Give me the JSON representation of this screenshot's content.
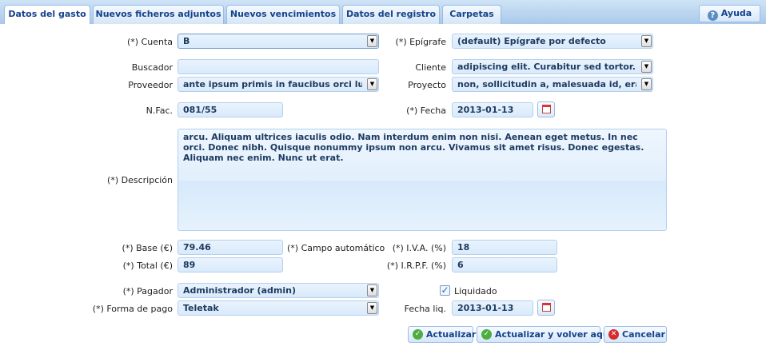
{
  "tabs": [
    {
      "label": "Datos del gasto",
      "active": true
    },
    {
      "label": "Nuevos ficheros adjuntos",
      "active": false
    },
    {
      "label": "Nuevos vencimientos",
      "active": false
    },
    {
      "label": "Datos del registro",
      "active": false
    },
    {
      "label": "Carpetas",
      "active": false
    }
  ],
  "help": {
    "label": "Ayuda",
    "icon": "help-icon"
  },
  "form": {
    "cuenta": {
      "label": "(*) Cuenta",
      "value": "B"
    },
    "epigrafe": {
      "label": "(*) Epígrafe",
      "value": "(default) Epígrafe por defecto"
    },
    "buscador": {
      "label": "Buscador",
      "value": ""
    },
    "cliente": {
      "label": "Cliente",
      "value": "adipiscing elit. Curabitur sed tortor."
    },
    "proveedor": {
      "label": "Proveedor",
      "value": "ante ipsum primis in faucibus orci luctus"
    },
    "proyecto": {
      "label": "Proyecto",
      "value": "non, sollicitudin a, malesuada id, erat. Eti"
    },
    "nfac": {
      "label": "N.Fac.",
      "value": "081/55"
    },
    "fecha": {
      "label": "(*) Fecha",
      "value": "2013-01-13"
    },
    "descripcion": {
      "label": "(*) Descripción",
      "value": "arcu. Aliquam ultrices iaculis odio. Nam interdum enim non nisi. Aenean eget metus. In nec orci. Donec nibh. Quisque nonummy ipsum non arcu. Vivamus sit amet risus. Donec egestas. Aliquam nec enim. Nunc ut erat."
    },
    "base": {
      "label": "(*) Base (€)",
      "value": "79.46"
    },
    "campo_automatico": {
      "label": "(*) Campo automático"
    },
    "iva": {
      "label": "(*) I.V.A. (%)",
      "value": "18"
    },
    "total": {
      "label": "(*) Total (€)",
      "value": "89"
    },
    "irpf": {
      "label": "(*) I.R.P.F. (%)",
      "value": "6"
    },
    "pagador": {
      "label": "(*) Pagador",
      "value": "Administrador (admin)"
    },
    "liquidado": {
      "label": "Liquidado",
      "checked": true
    },
    "forma_pago": {
      "label": "(*) Forma de pago",
      "value": "Teletak"
    },
    "fecha_liq": {
      "label": "Fecha liq.",
      "value": "2013-01-13"
    }
  },
  "buttons": {
    "actualizar": "Actualizar",
    "actualizar_volver": "Actualizar y volver aquí",
    "cancelar": "Cancelar"
  },
  "colors": {
    "accent": "#15428b",
    "field_bg": "#e1effc",
    "tab_border": "#99bbe8"
  }
}
